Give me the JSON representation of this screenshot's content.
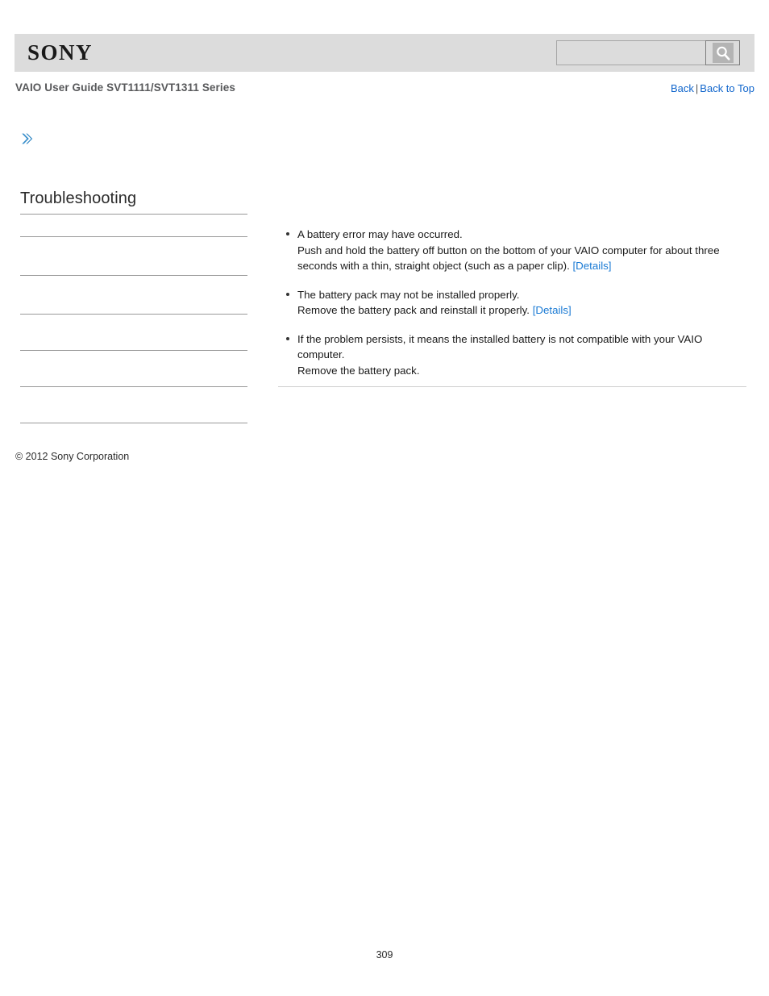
{
  "header": {
    "logo_text": "SONY",
    "search": {
      "value": "",
      "placeholder": "",
      "icon": "search-icon",
      "button_label": ""
    }
  },
  "subheader": {
    "guide_title": "VAIO User Guide SVT1111/SVT1311 Series",
    "nav": {
      "back_label": "Back",
      "separator": "|",
      "back_to_top_label": "Back to Top"
    }
  },
  "sidebar": {
    "marker_icon": "double-chevron-right-icon",
    "section_title": "Troubleshooting",
    "items": [
      {
        "label": ""
      },
      {
        "label": ""
      },
      {
        "label": ""
      },
      {
        "label": ""
      },
      {
        "label": ""
      },
      {
        "label": ""
      }
    ],
    "copyright": "© 2012 Sony Corporation"
  },
  "main": {
    "bullets": [
      {
        "lines": [
          {
            "text": "A battery error may have occurred.",
            "link": null
          },
          {
            "text": "Push and hold the battery off button on the bottom of your VAIO computer for about three seconds with a thin, straight object (such as a paper clip). ",
            "link": "[Details]"
          }
        ]
      },
      {
        "lines": [
          {
            "text": "The battery pack may not be installed properly.",
            "link": null
          },
          {
            "text": "Remove the battery pack and reinstall it properly. ",
            "link": "[Details]"
          }
        ]
      },
      {
        "lines": [
          {
            "text": "If the problem persists, it means the installed battery is not compatible with your VAIO computer.",
            "link": null
          },
          {
            "text": "Remove the battery pack.",
            "link": null
          }
        ]
      }
    ]
  },
  "footer": {
    "page_number": "309"
  },
  "colors": {
    "header_band": "#dcdcdc",
    "link_blue": "#1166cc",
    "details_blue": "#1a7ad4",
    "chevron_blue": "#3a8fcb",
    "rule_gray": "#999999"
  }
}
